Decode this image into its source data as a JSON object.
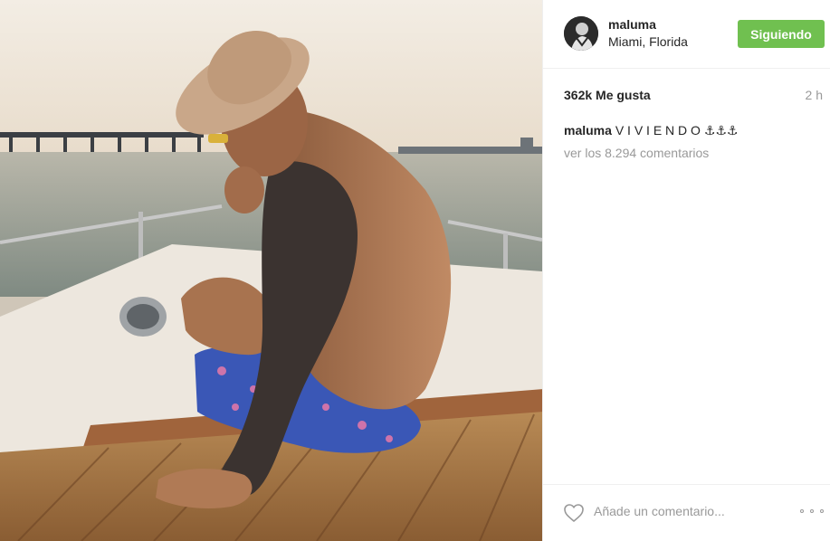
{
  "post": {
    "user": {
      "username": "maluma",
      "location": "Miami, Florida"
    },
    "follow_button": "Siguiendo",
    "likes": "362k Me gusta",
    "time": "2 h",
    "caption": {
      "username": "maluma",
      "text": "V I V I E N D O ⚓⚓⚓"
    },
    "view_comments": "ver los 8.294 comentarios",
    "comment_placeholder": "Añade un comentario...",
    "icons": {
      "like": "heart-outline-icon",
      "more": "more-options-icon"
    }
  },
  "colors": {
    "follow_button": "#70c050",
    "muted_text": "#999999",
    "text": "#262626",
    "divider": "#efefef"
  }
}
